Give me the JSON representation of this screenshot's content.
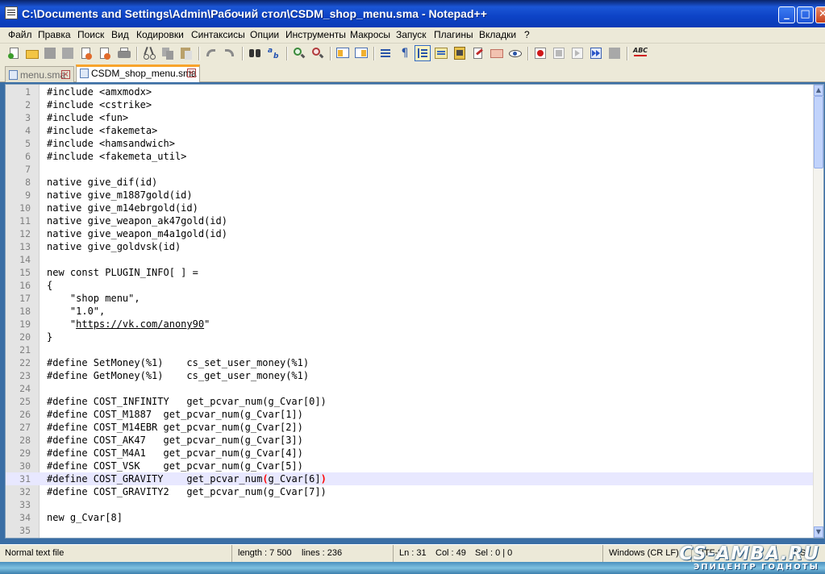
{
  "window": {
    "title": "C:\\Documents and Settings\\Admin\\Рабочий стол\\CSDM_shop_menu.sma - Notepad++",
    "buttons": {
      "minimize": "_",
      "maximize": "□",
      "close": "✕"
    }
  },
  "menu": [
    "Файл",
    "Правка",
    "Поиск",
    "Вид",
    "Кодировки",
    "Синтаксисы",
    "Опции",
    "Инструменты",
    "Макросы",
    "Запуск",
    "Плагины",
    "Вкладки",
    "?"
  ],
  "toolbar": {
    "icons": [
      "new-file-icon",
      "open-file-icon",
      "save-icon",
      "save-all-icon",
      "close-icon",
      "close-all-icon",
      "print-icon",
      "cut-icon",
      "copy-icon",
      "paste-icon",
      "undo-icon",
      "redo-icon",
      "find-icon",
      "replace-icon",
      "zoom-in-icon",
      "zoom-out-icon",
      "sync-vertical-icon",
      "sync-horizontal-icon",
      "word-wrap-icon",
      "show-all-chars-icon",
      "indent-guide-icon",
      "user-language-icon",
      "doc-map-icon",
      "function-list-icon",
      "folder-workspace-icon",
      "monitoring-icon",
      "record-macro-icon",
      "stop-macro-icon",
      "play-macro-icon",
      "run-macro-multiple-icon",
      "save-macro-icon",
      "spell-check-icon"
    ],
    "spell_label": "ABC"
  },
  "tabs": [
    {
      "label": "menu.sma",
      "active": false
    },
    {
      "label": "CSDM_shop_menu.sma",
      "active": true
    }
  ],
  "editor": {
    "current_line": 31,
    "lines": [
      "#include <amxmodx>",
      "#include <cstrike>",
      "#include <fun>",
      "#include <fakemeta>",
      "#include <hamsandwich>",
      "#include <fakemeta_util>",
      "",
      "native give_dif(id)",
      "native give_m1887gold(id)",
      "native give_m14ebrgold(id)",
      "native give_weapon_ak47gold(id)",
      "native give_weapon_m4a1gold(id)",
      "native give_goldvsk(id)",
      "",
      "new const PLUGIN_INFO[ ] =",
      "{",
      "    \"shop menu\",",
      "    \"1.0\",",
      "    \"https://vk.com/anony90\"",
      "}",
      "",
      "#define SetMoney(%1)    cs_set_user_money(%1)",
      "#define GetMoney(%1)    cs_get_user_money(%1)",
      "",
      "#define COST_INFINITY   get_pcvar_num(g_Cvar[0])",
      "#define COST_M1887  get_pcvar_num(g_Cvar[1])",
      "#define COST_M14EBR get_pcvar_num(g_Cvar[2])",
      "#define COST_AK47   get_pcvar_num(g_Cvar[3])",
      "#define COST_M4A1   get_pcvar_num(g_Cvar[4])",
      "#define COST_VSK    get_pcvar_num(g_Cvar[5])",
      "#define COST_GRAVITY    get_pcvar_num(g_Cvar[6])",
      "#define COST_GRAVITY2   get_pcvar_num(g_Cvar[7])",
      "",
      "new g_Cvar[8]",
      ""
    ]
  },
  "status": {
    "type": "Normal text file",
    "length": "length : 7 500",
    "lines": "lines : 236",
    "ln": "Ln : 31",
    "col": "Col : 49",
    "sel": "Sel : 0 | 0",
    "eol": "Windows (CR LF)",
    "enc": "UTF-8",
    "mode": "INS"
  },
  "watermark": {
    "logo": "CS-AMBA.RU",
    "tagline": "ЭПИЦЕНТР ГОДНОТЫ"
  }
}
